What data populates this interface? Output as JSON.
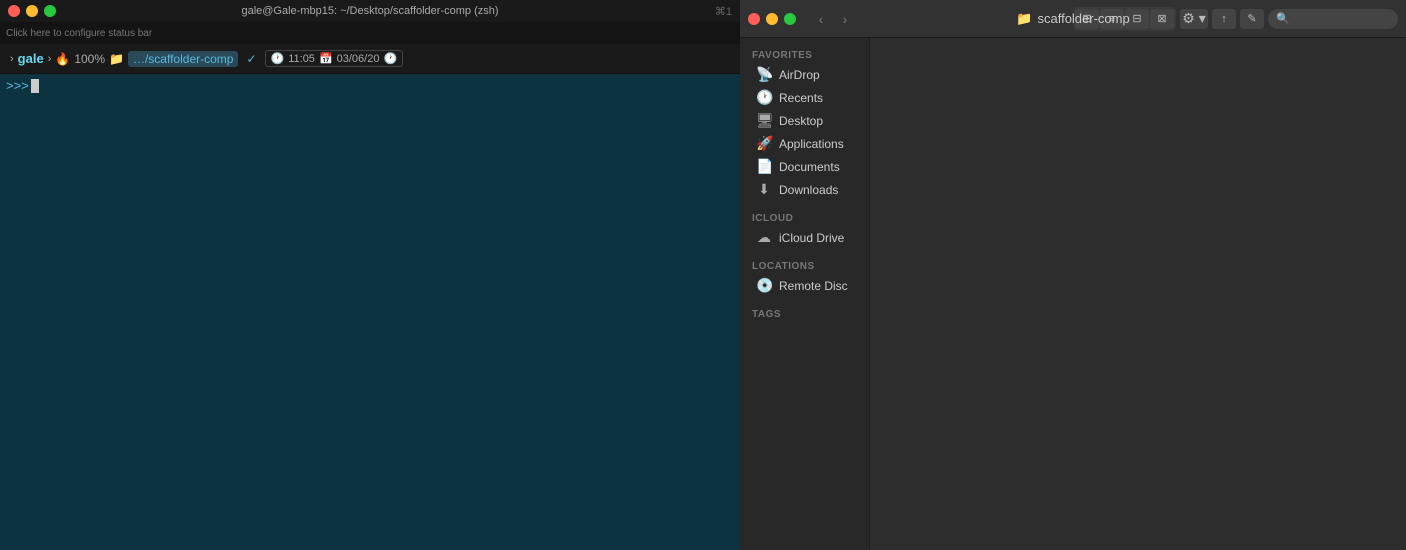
{
  "terminal": {
    "title": "gale@Gale-mbp15: ~/Desktop/scaffolder-comp (zsh)",
    "shortcut": "⌘1",
    "status_bar_text": "Click here to configure status bar",
    "prompt": {
      "user": "gale",
      "path": "…/scaffolder-comp",
      "time": "11:05",
      "date": "03/06/20"
    },
    "cursor_line": ">>>"
  },
  "finder": {
    "title": "scaffolder-comp",
    "sidebar": {
      "favorites_label": "Favorites",
      "icloud_label": "iCloud",
      "locations_label": "Locations",
      "tags_label": "Tags",
      "items": [
        {
          "label": "AirDrop",
          "icon": "📡"
        },
        {
          "label": "Recents",
          "icon": "🕐"
        },
        {
          "label": "Desktop",
          "icon": "🖥"
        },
        {
          "label": "Applications",
          "icon": "🚀"
        },
        {
          "label": "Documents",
          "icon": "📄"
        },
        {
          "label": "Downloads",
          "icon": "⬇"
        }
      ],
      "icloud_items": [
        {
          "label": "iCloud Drive",
          "icon": "☁"
        }
      ],
      "location_items": [
        {
          "label": "Remote Disc",
          "icon": "💿"
        }
      ]
    },
    "toolbar": {
      "back_label": "‹",
      "forward_label": "›",
      "view_icons": [
        "⊞",
        "≡",
        "⊟",
        "⊠"
      ],
      "share_label": "↑",
      "action_label": "⚙",
      "search_placeholder": "Search"
    }
  }
}
